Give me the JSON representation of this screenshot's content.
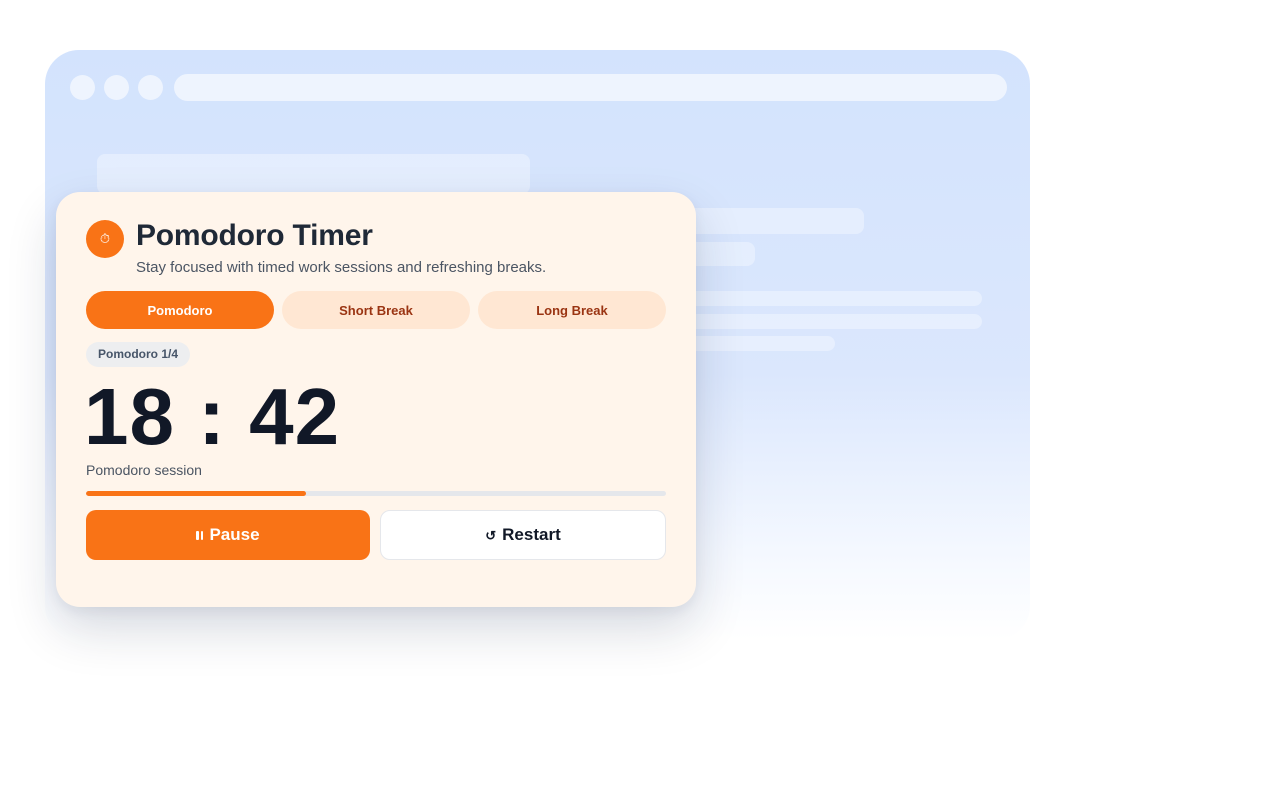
{
  "app": {
    "title": "Pomodoro Timer",
    "subtitle": "Stay focused with timed work sessions and refreshing breaks.",
    "logo_icon": "stopwatch-icon",
    "logo_glyph": "⏱"
  },
  "modes": [
    {
      "label": "Pomodoro",
      "active": true
    },
    {
      "label": "Short Break",
      "active": false
    },
    {
      "label": "Long Break",
      "active": false
    }
  ],
  "counter": "Pomodoro 1/4",
  "timer": {
    "display": "18 : 42",
    "session_label": "Pomodoro session",
    "progress": 0.38
  },
  "controls": {
    "pause_label": "Pause",
    "pause_icon": "pause-icon",
    "restart_label": "Restart",
    "restart_icon": "restart-icon",
    "restart_glyph": "↺"
  },
  "colors": {
    "accent": "#f97316",
    "card_bg": "#fff5eb",
    "mode_inactive_bg": "#ffe7d3",
    "mode_inactive_text": "#9a3412",
    "backdrop": "#d3e3fd"
  }
}
